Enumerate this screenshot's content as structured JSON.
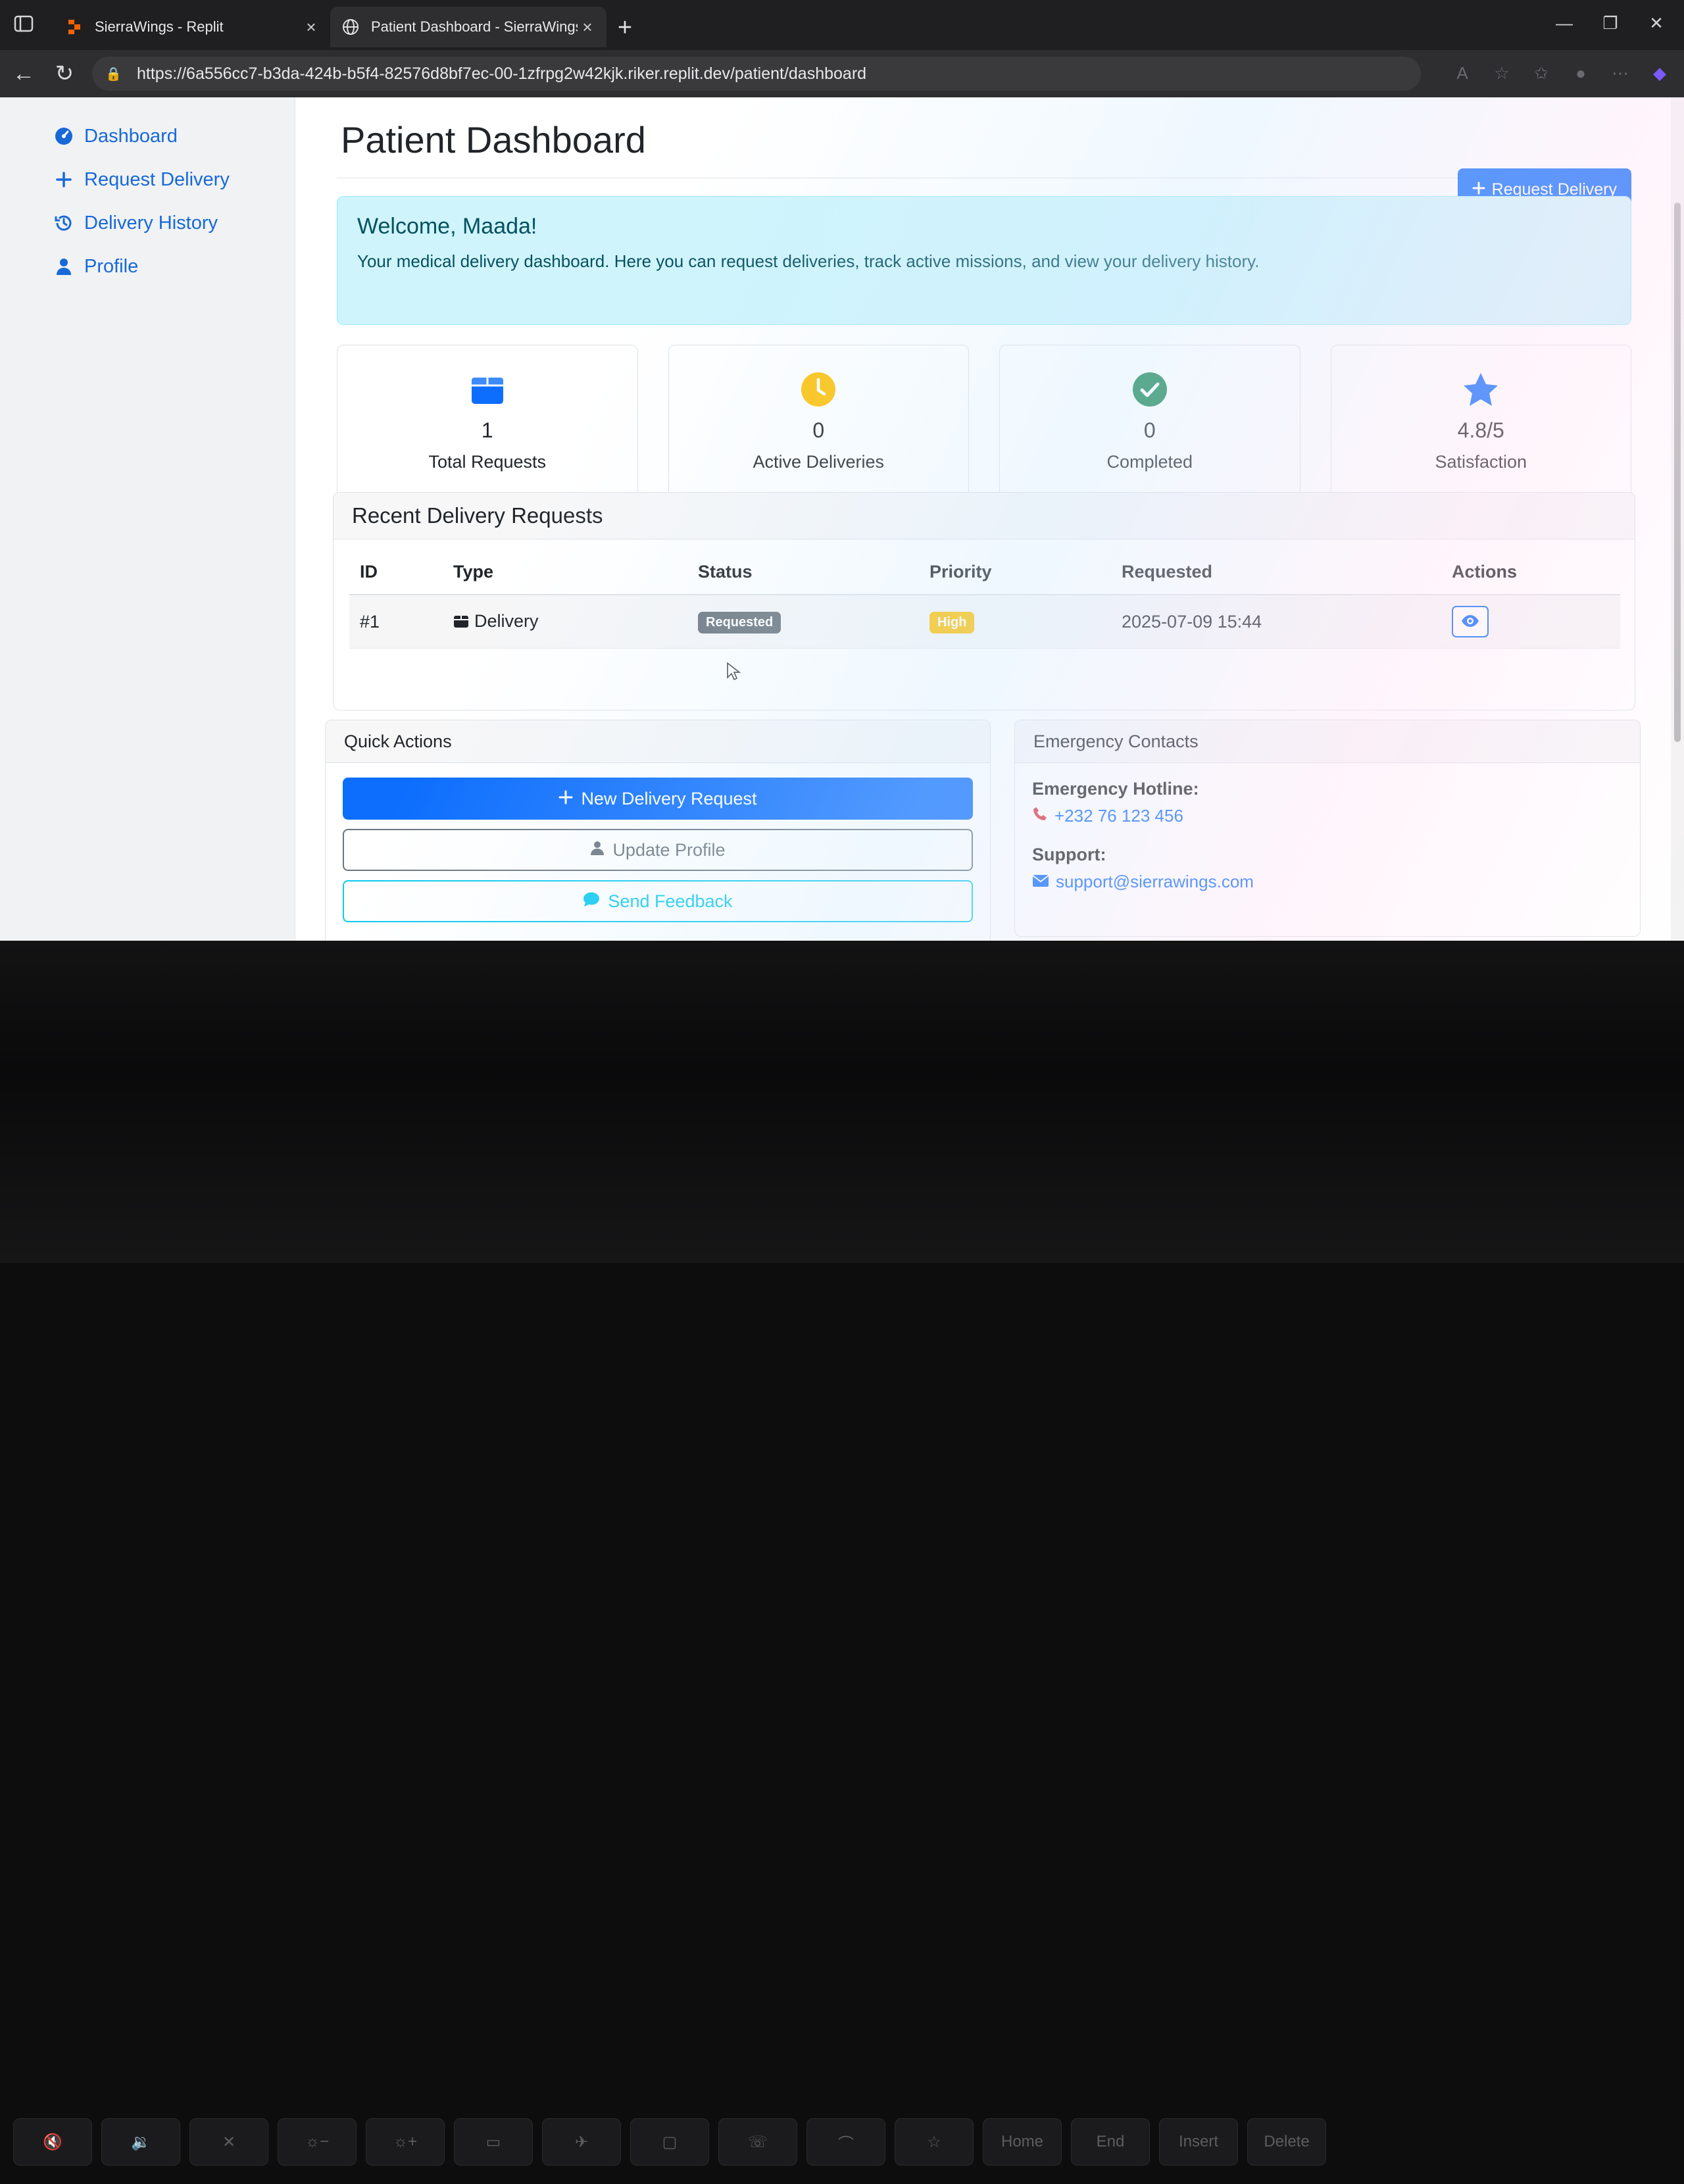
{
  "browser": {
    "tabs": [
      {
        "title": "SierraWings - Replit",
        "favicon": "replit-icon",
        "active": false
      },
      {
        "title": "Patient Dashboard - SierraWings",
        "favicon": "globe-icon",
        "active": true
      }
    ],
    "url": "https://6a556cc7-b3da-424b-b5f4-82576d8bf7ec-00-1zfrpg2w42kjk.riker.replit.dev/patient/dashboard"
  },
  "sidebar": {
    "items": [
      {
        "label": "Dashboard",
        "icon": "tachometer-icon"
      },
      {
        "label": "Request Delivery",
        "icon": "plus-icon"
      },
      {
        "label": "Delivery History",
        "icon": "history-icon"
      },
      {
        "label": "Profile",
        "icon": "user-icon"
      }
    ]
  },
  "page": {
    "title": "Patient Dashboard",
    "request_button": "Request Delivery"
  },
  "welcome": {
    "heading": "Welcome, Maada!",
    "text": "Your medical delivery dashboard. Here you can request deliveries, track active missions, and view your delivery history."
  },
  "stats": [
    {
      "value": "1",
      "label": "Total Requests",
      "icon": "box-icon",
      "color": "#0d6efd"
    },
    {
      "value": "0",
      "label": "Active Deliveries",
      "icon": "clock-icon",
      "color": "#ffc107"
    },
    {
      "value": "0",
      "label": "Completed",
      "icon": "check-circle-icon",
      "color": "#198754"
    },
    {
      "value": "4.8/5",
      "label": "Satisfaction",
      "icon": "star-icon",
      "color": "#0d6efd"
    }
  ],
  "recent": {
    "title": "Recent Delivery Requests",
    "columns": [
      "ID",
      "Type",
      "Status",
      "Priority",
      "Requested",
      "Actions"
    ],
    "rows": [
      {
        "id": "#1",
        "type": "Delivery",
        "status": "Requested",
        "priority": "High",
        "requested": "2025-07-09 15:44"
      }
    ]
  },
  "quick_actions": {
    "title": "Quick Actions",
    "new_request": "New Delivery Request",
    "update_profile": "Update Profile",
    "send_feedback": "Send Feedback"
  },
  "emergency": {
    "title": "Emergency Contacts",
    "hotline_label": "Emergency Hotline:",
    "hotline": "+232 76 123 456",
    "support_label": "Support:",
    "support_email": "support@sierrawings.com"
  },
  "keyboard": {
    "keys": [
      "Home",
      "End",
      "Insert",
      "Delete"
    ]
  },
  "colors": {
    "primary": "#0d6efd",
    "alert_bg": "#cff4fc",
    "sidebar_link": "#1769d8"
  }
}
